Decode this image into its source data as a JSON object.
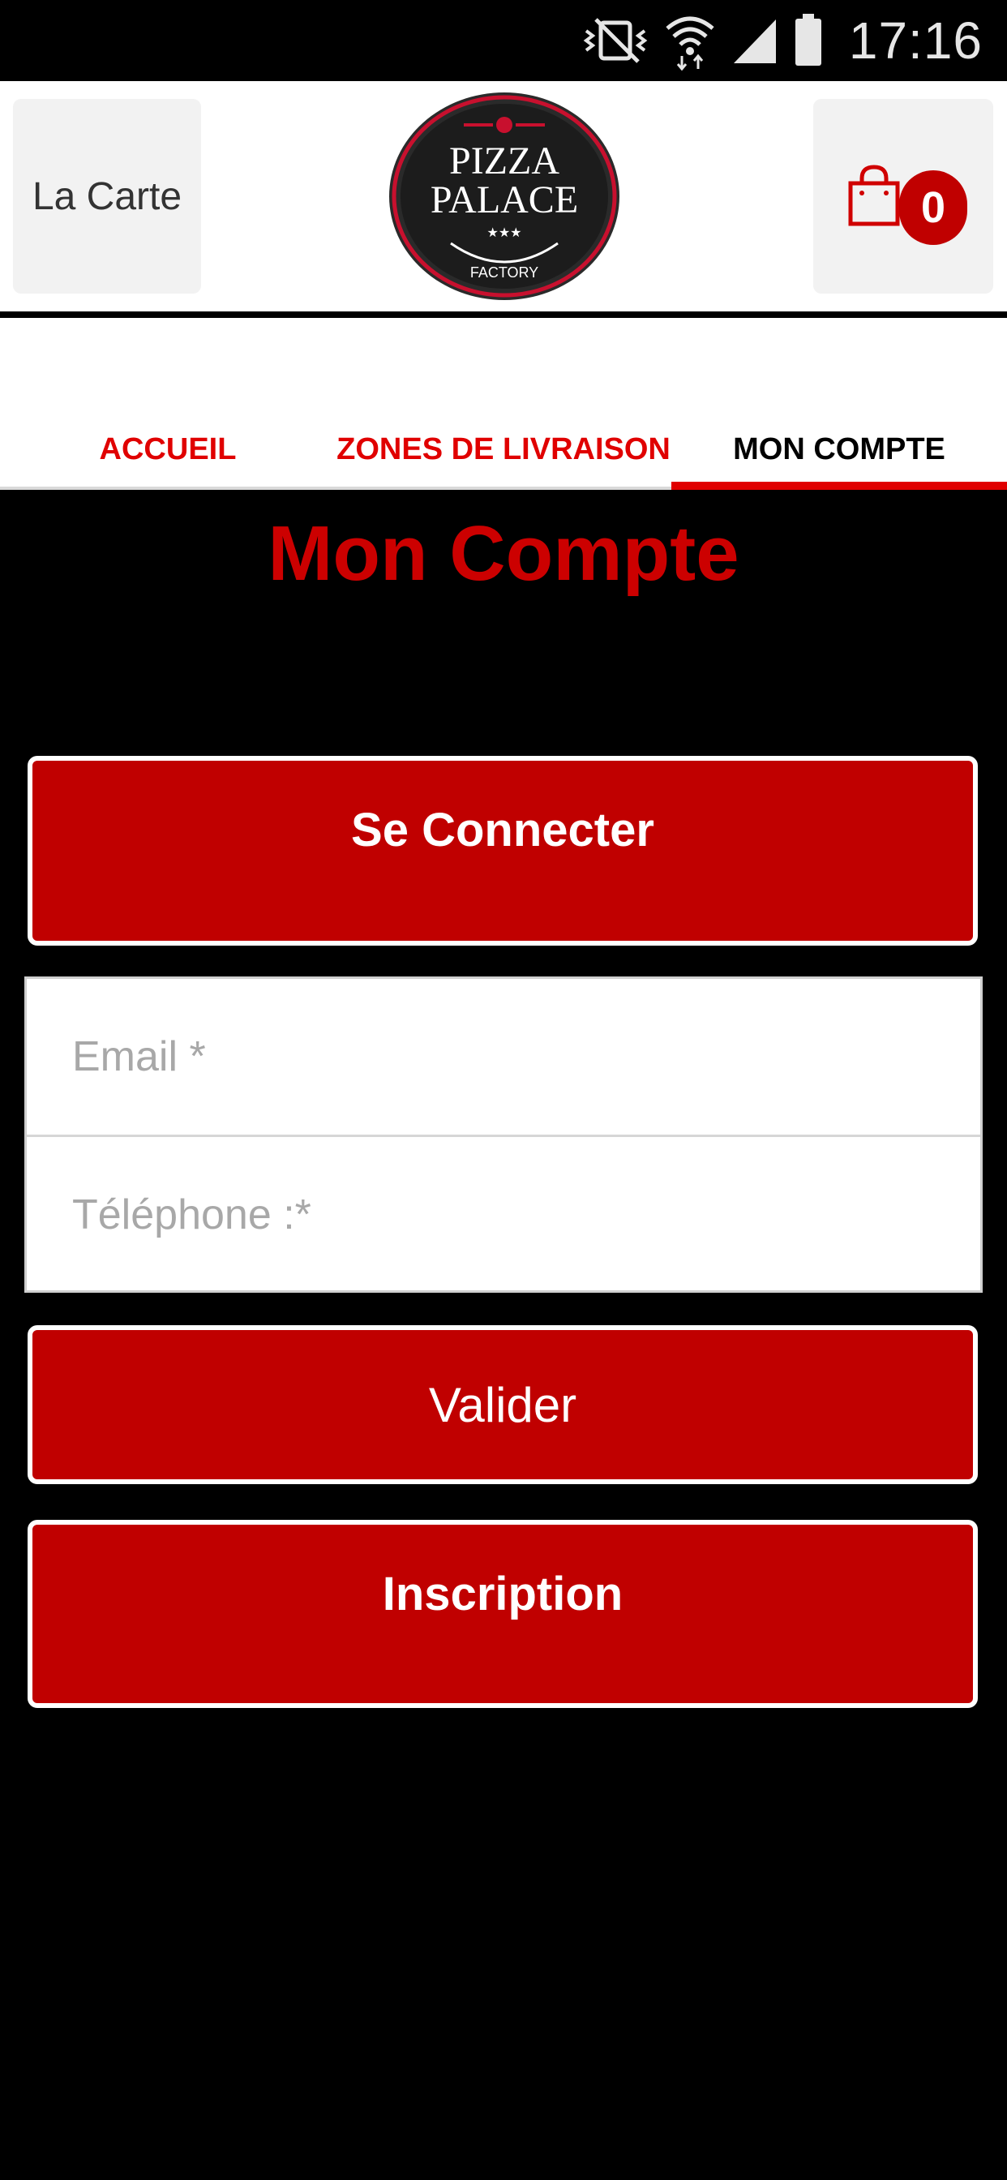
{
  "status_bar": {
    "time": "17:16",
    "icons": [
      "vibrate-off-icon",
      "wifi-icon",
      "signal-icon",
      "battery-icon"
    ]
  },
  "header": {
    "menu_label": "La Carte",
    "logo": {
      "line1": "PIZZA",
      "line2": "PALACE",
      "stars": "★★★",
      "line3": "FACTORY"
    },
    "cart_count": "0"
  },
  "tabs": [
    {
      "label": "ACCUEIL",
      "active": false
    },
    {
      "label": "ZONES DE LIVRAISON",
      "active": false
    },
    {
      "label": "MON COMPTE",
      "active": true
    }
  ],
  "main": {
    "title": "Mon Compte",
    "login_button": "Se Connecter",
    "email_placeholder": "Email *",
    "phone_placeholder": "Téléphone :*",
    "validate_button": "Valider",
    "register_button": "Inscription"
  },
  "colors": {
    "accent_red": "#c00000",
    "tab_red": "#e00000",
    "background": "#000000"
  }
}
